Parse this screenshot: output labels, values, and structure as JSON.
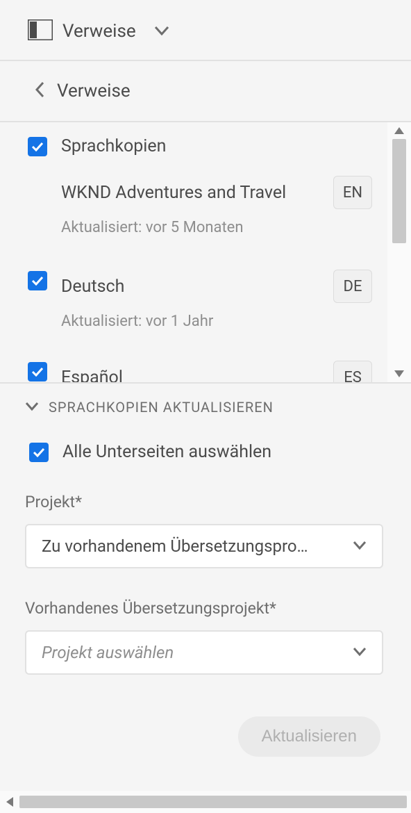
{
  "rail": {
    "title": "Verweise"
  },
  "back": {
    "title": "Verweise"
  },
  "section": {
    "label": "Sprachkopien"
  },
  "items": [
    {
      "title": "WKND Adventures and Travel",
      "meta": "Aktualisiert: vor 5 Monaten",
      "badge": "EN",
      "checkbox": false
    },
    {
      "title": "Deutsch",
      "meta": "Aktualisiert: vor 1 Jahr",
      "badge": "DE",
      "checkbox": true
    },
    {
      "title": "Español",
      "meta": "",
      "badge": "ES",
      "checkbox": true
    }
  ],
  "accordion": {
    "title": "SPRACHKOPIEN AKTUALISIEREN"
  },
  "subselect": {
    "label": "Alle Unterseiten auswählen"
  },
  "fields": {
    "project": {
      "label": "Projekt*",
      "value": "Zu vorhandenem Übersetzungspro…"
    },
    "existing": {
      "label": "Vorhandenes Übersetzungsprojekt*",
      "placeholder": "Projekt auswählen"
    }
  },
  "actions": {
    "update": "Aktualisieren"
  }
}
